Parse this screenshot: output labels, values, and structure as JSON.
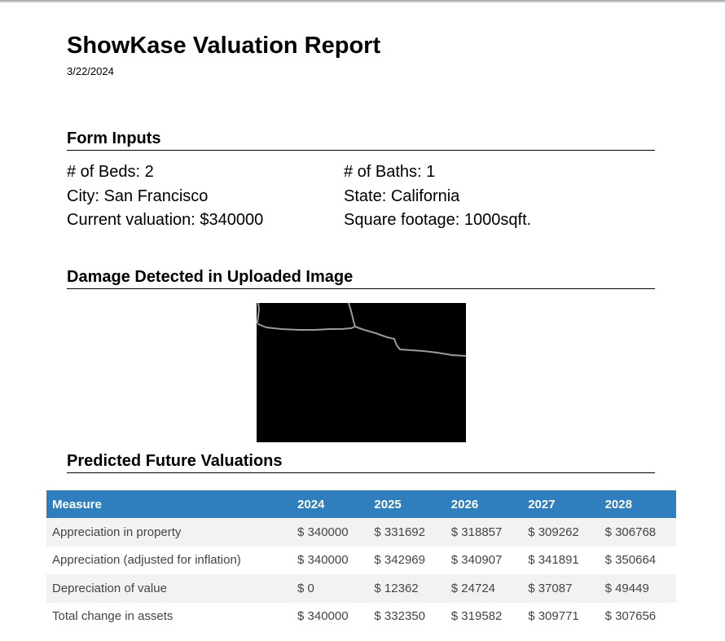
{
  "report": {
    "title": "ShowKase Valuation Report",
    "date": "3/22/2024"
  },
  "form_inputs": {
    "heading": "Form Inputs",
    "beds": "# of Beds: 2",
    "baths": "# of Baths: 1",
    "city": "City: San Francisco",
    "state": "State: California",
    "valuation": "Current valuation: $340000",
    "sqft": "Square footage: 1000sqft."
  },
  "damage": {
    "heading": "Damage Detected in Uploaded Image"
  },
  "predictions": {
    "heading": "Predicted Future Valuations",
    "columns": [
      "Measure",
      "2024",
      "2025",
      "2026",
      "2027",
      "2028"
    ],
    "rows": [
      [
        "Appreciation in property",
        "$ 340000",
        "$ 331692",
        "$ 318857",
        "$ 309262",
        "$ 306768"
      ],
      [
        "Appreciation (adjusted for inflation)",
        "$ 340000",
        "$ 342969",
        "$ 340907",
        "$ 341891",
        "$ 350664"
      ],
      [
        "Depreciation of value",
        "$ 0",
        "$ 12362",
        "$ 24724",
        "$ 37087",
        "$ 49449"
      ],
      [
        "Total change in assets",
        "$ 340000",
        "$ 332350",
        "$ 319582",
        "$ 309771",
        "$ 307656"
      ]
    ]
  }
}
